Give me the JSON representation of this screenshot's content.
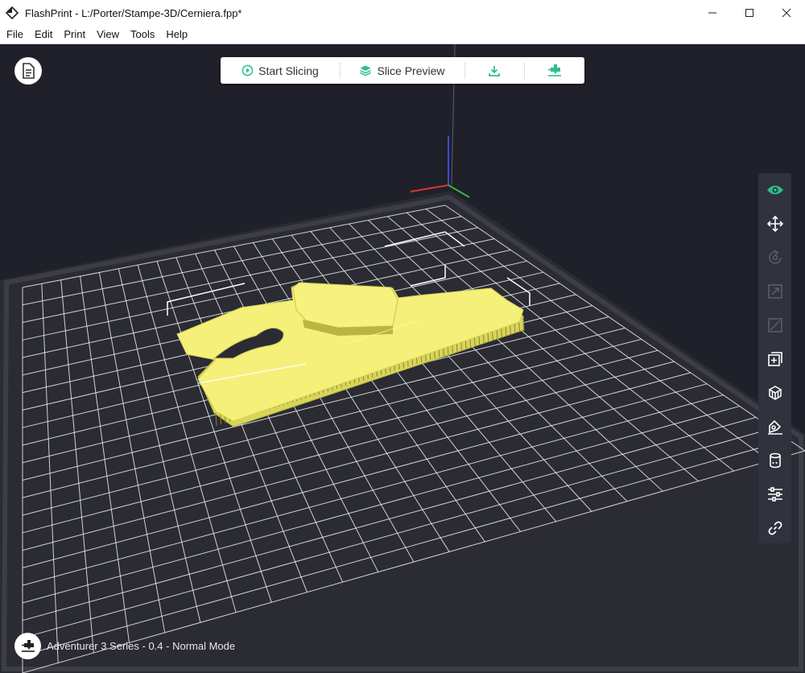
{
  "window": {
    "title": "FlashPrint - L:/Porter/Stampe-3D/Cerniera.fpp*",
    "controls": [
      "minimize-icon",
      "maximize-icon",
      "close-icon"
    ]
  },
  "menu": [
    "File",
    "Edit",
    "Print",
    "View",
    "Tools",
    "Help"
  ],
  "toolbar": {
    "start_slicing": "Start Slicing",
    "slice_preview": "Slice Preview",
    "export_icon": "download-icon",
    "machine_icon": "extruder-icon",
    "accent": "#2bbf8e"
  },
  "right_tools": [
    {
      "name": "view-icon",
      "state": "active"
    },
    {
      "name": "move-icon",
      "state": "enabled"
    },
    {
      "name": "rotate-icon",
      "state": "disabled"
    },
    {
      "name": "scale-icon",
      "state": "disabled"
    },
    {
      "name": "cut-icon",
      "state": "disabled"
    },
    {
      "name": "add-object-icon",
      "state": "enabled"
    },
    {
      "name": "supports-icon",
      "state": "enabled"
    },
    {
      "name": "lay-flat-icon",
      "state": "enabled"
    },
    {
      "name": "cylinder-icon",
      "state": "enabled"
    },
    {
      "name": "settings-sliders-icon",
      "state": "enabled"
    },
    {
      "name": "link-icon",
      "state": "enabled"
    }
  ],
  "status": {
    "printer": "Adventurer 3 Series - 0.4 - Normal Mode"
  },
  "colors": {
    "viewport_bg": "#1f2029",
    "plate": "#2a2b33",
    "grid_line": "#f0f0f0",
    "model": "#f4f07a",
    "panel": "#30323d"
  }
}
